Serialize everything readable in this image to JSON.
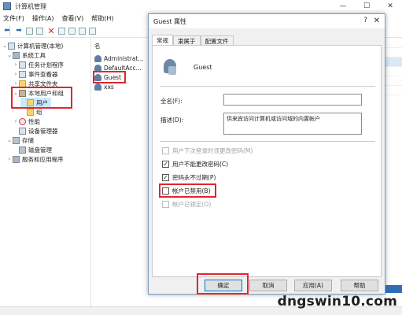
{
  "window": {
    "title": "计算机管理",
    "controls": {
      "minimize": "—",
      "maximize": "☐",
      "close": "✕"
    }
  },
  "menu": [
    "文件(F)",
    "操作(A)",
    "查看(V)",
    "帮助(H)"
  ],
  "tree": [
    {
      "label": "计算机管理(本地)",
      "icon": "computer-icon"
    },
    {
      "label": "系统工具",
      "icon": "tools-icon"
    },
    {
      "label": "任务计划程序",
      "icon": "clock-icon"
    },
    {
      "label": "事件查看器",
      "icon": "event-icon"
    },
    {
      "label": "共享文件夹",
      "icon": "folder-icon"
    },
    {
      "label": "本地用户和组",
      "icon": "users-icon"
    },
    {
      "label": "用户",
      "icon": "folder-icon"
    },
    {
      "label": "组",
      "icon": "folder-icon"
    },
    {
      "label": "性能",
      "icon": "performance-icon"
    },
    {
      "label": "设备管理器",
      "icon": "device-icon"
    },
    {
      "label": "存储",
      "icon": "storage-icon"
    },
    {
      "label": "磁盘管理",
      "icon": "disk-icon"
    },
    {
      "label": "服务和应用程序",
      "icon": "services-icon"
    }
  ],
  "list": {
    "column": "名",
    "items": [
      "Administrat...",
      "DefaultAcc...",
      "Guest",
      "xxs"
    ]
  },
  "dialog": {
    "title": "Guest 属性",
    "help": "?",
    "close": "✕",
    "tabs": [
      "常规",
      "隶属于",
      "配置文件"
    ],
    "username": "Guest",
    "fullname_label": "全名(F):",
    "fullname_value": "",
    "description_label": "描述(D):",
    "description_value": "供来宾访问计算机或访问域的内置帐户",
    "checkboxes": [
      {
        "label": "用户下次登录时须更改密码(M)",
        "checked": false,
        "disabled": true
      },
      {
        "label": "用户不能更改密码(C)",
        "checked": true,
        "disabled": false
      },
      {
        "label": "密码永不过期(P)",
        "checked": true,
        "disabled": false
      },
      {
        "label": "帐户已禁用(B)",
        "checked": false,
        "disabled": false
      },
      {
        "label": "帐户已锁定(O)",
        "checked": false,
        "disabled": true
      }
    ],
    "buttons": {
      "ok": "确定",
      "cancel": "取消",
      "apply": "应用(A)",
      "help": "帮助"
    }
  },
  "watermark": "dngswin10.com",
  "colors": {
    "highlight": "#e0262e",
    "accent": "#0078d7"
  }
}
